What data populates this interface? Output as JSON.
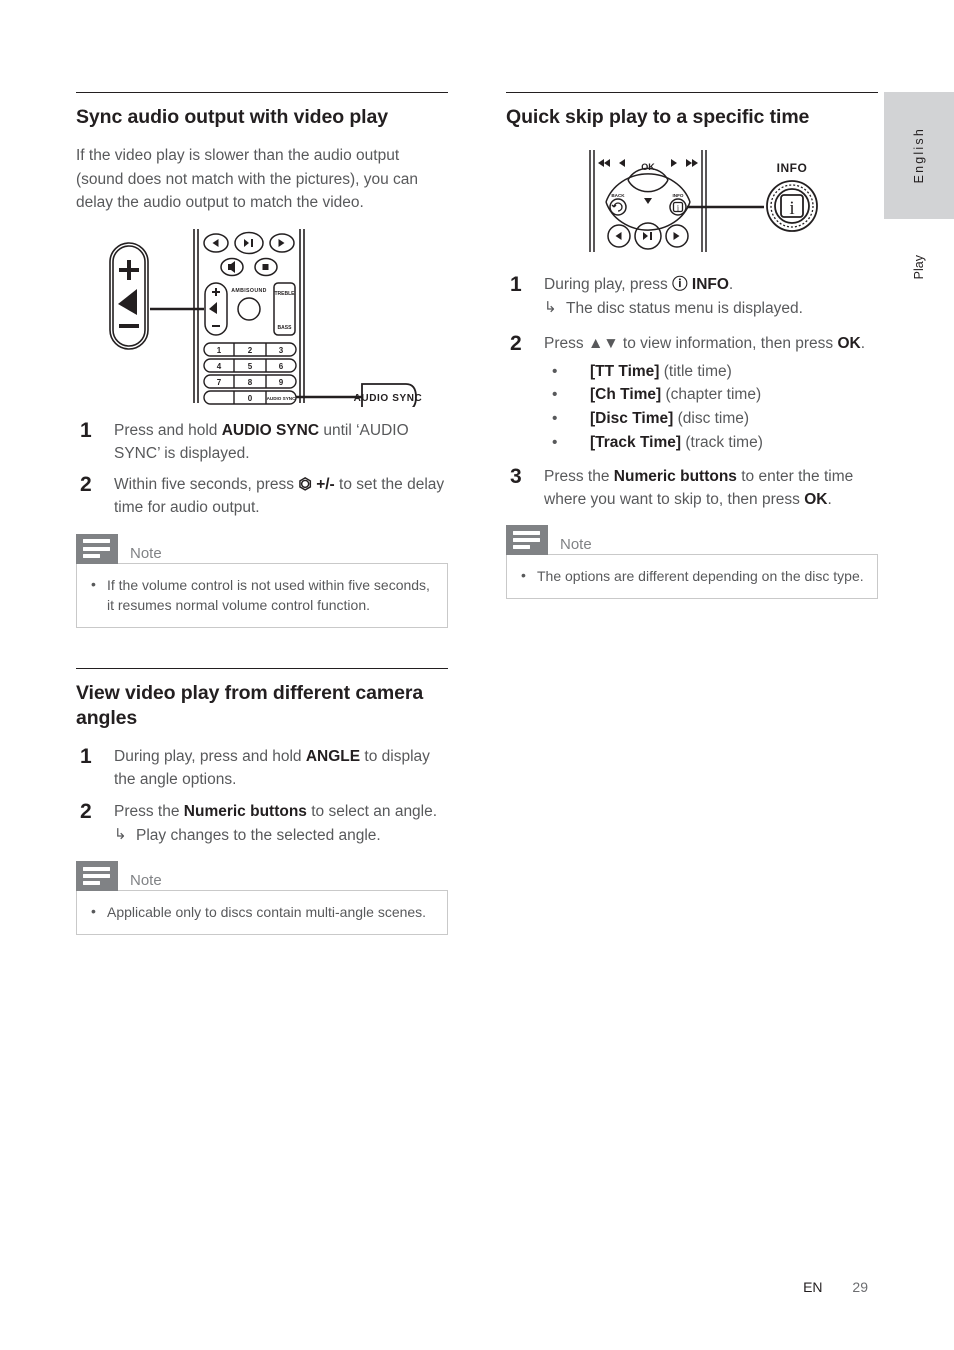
{
  "page": {
    "language_tab": "English",
    "section_tab": "Play",
    "footer_locale": "EN",
    "footer_page": "29"
  },
  "colors": {
    "heading": "#231f20",
    "body": "#58595b",
    "note_icon_bg": "#808285",
    "note_border": "#c9c9c9",
    "tab_bg": "#d2d3d5"
  },
  "left_column": {
    "sections": [
      {
        "heading": "Sync audio output with video play",
        "intro": "If the video play is slower than the audio output (sound does not match with the pictures), you can delay the audio output to match the video.",
        "figure": {
          "name": "remote-control-audio-sync-diagram",
          "callout_volume": {
            "plus": "+",
            "minus": "–",
            "icon": "volume-icon"
          },
          "callout_button": "AUDIO SYNC",
          "remote_keys": [
            "1",
            "2",
            "3",
            "4",
            "5",
            "6",
            "7",
            "8",
            "9",
            "0"
          ],
          "remote_labels": [
            "AMBISOUND",
            "TREBLE",
            "BASS",
            "AUDIO SYNC"
          ]
        },
        "steps": [
          {
            "num": "1",
            "parts": [
              {
                "t": "Press and hold ",
                "b": false
              },
              {
                "t": "AUDIO SYNC",
                "b": true
              },
              {
                "t": " until ‘AUDIO SYNC’ is displayed.",
                "b": false
              }
            ]
          },
          {
            "num": "2",
            "parts": [
              {
                "t": "Within five seconds, press ",
                "b": false
              },
              {
                "t": "⏷ +/-",
                "b": true
              },
              {
                "t": " to set the delay time for audio output.",
                "b": false
              }
            ]
          }
        ],
        "note": {
          "title": "Note",
          "items": [
            "If the volume control is not used within five seconds, it resumes normal volume control function."
          ]
        }
      },
      {
        "heading": "View video play from different camera angles",
        "steps": [
          {
            "num": "1",
            "parts": [
              {
                "t": "During play, press and hold ",
                "b": false
              },
              {
                "t": "ANGLE",
                "b": true
              },
              {
                "t": " to display the angle options.",
                "b": false
              }
            ]
          },
          {
            "num": "2",
            "parts": [
              {
                "t": "Press the ",
                "b": false
              },
              {
                "t": "Numeric buttons",
                "b": true
              },
              {
                "t": " to select an angle.",
                "b": false
              }
            ],
            "result": "Play changes to the selected angle."
          }
        ],
        "note": {
          "title": "Note",
          "items": [
            "Applicable only to discs contain multi-angle scenes."
          ]
        }
      }
    ]
  },
  "right_column": {
    "sections": [
      {
        "heading": "Quick skip play to a specific time",
        "figure": {
          "name": "remote-control-info-diagram",
          "callout_label": "INFO",
          "remote_labels": [
            "OK",
            "BACK",
            "INFO"
          ]
        },
        "steps": [
          {
            "num": "1",
            "parts": [
              {
                "t": "During play, press ",
                "b": false
              },
              {
                "t": "ⓘ INFO",
                "b": true
              },
              {
                "t": ".",
                "b": false
              }
            ],
            "result": "The disc status menu is displayed."
          },
          {
            "num": "2",
            "parts": [
              {
                "t": "Press ",
                "b": false
              },
              {
                "t": "▲▼",
                "b": false
              },
              {
                "t": " to view information, then press ",
                "b": false
              },
              {
                "t": "OK",
                "b": true
              },
              {
                "t": ".",
                "b": false
              }
            ],
            "bullets": [
              {
                "bold": "[TT Time]",
                "rest": " (title time)"
              },
              {
                "bold": "[Ch Time]",
                "rest": " (chapter time)"
              },
              {
                "bold": "[Disc Time]",
                "rest": " (disc time)"
              },
              {
                "bold": "[Track Time]",
                "rest": " (track time)"
              }
            ]
          },
          {
            "num": "3",
            "parts": [
              {
                "t": "Press the ",
                "b": false
              },
              {
                "t": "Numeric buttons",
                "b": true
              },
              {
                "t": " to enter the time where you want to skip to, then press ",
                "b": false
              },
              {
                "t": "OK",
                "b": true
              },
              {
                "t": ".",
                "b": false
              }
            ]
          }
        ],
        "note": {
          "title": "Note",
          "items": [
            "The options are different depending on the disc type."
          ]
        }
      }
    ]
  }
}
